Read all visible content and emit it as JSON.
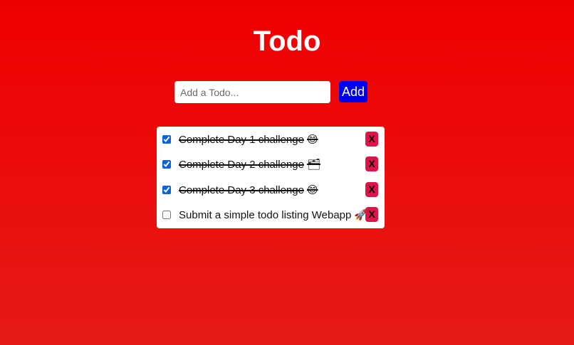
{
  "header": {
    "title": "Todo"
  },
  "add_form": {
    "placeholder": "Add a Todo...",
    "value": "",
    "add_label": "Add"
  },
  "todos": [
    {
      "text": "Complete Day 1 challenge",
      "emoji": "😊",
      "completed": true,
      "delete_label": "X"
    },
    {
      "text": "Complete Day 2 challenge",
      "emoji": "🗂",
      "completed": true,
      "delete_label": "X"
    },
    {
      "text": "Complete Day 3 challenge",
      "emoji": "😊",
      "completed": true,
      "delete_label": "X"
    },
    {
      "text": "Submit a simple todo listing Webapp",
      "emoji": "🚀",
      "completed": false,
      "delete_label": "X"
    }
  ],
  "colors": {
    "background_top": "#ef0000",
    "background_bottom": "#e61a16",
    "add_button": "#0000ee",
    "delete_button": "#dc1447",
    "checkbox": "#0a66d8"
  }
}
